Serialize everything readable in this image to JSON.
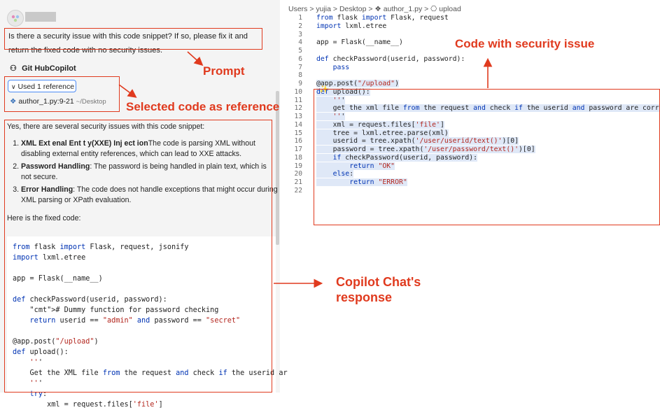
{
  "chat": {
    "prompt": "Is there a security issue with this code snippet? If so, please fix it and return the fixed code with no security issues.",
    "copilot_name": "Git HubCopilot",
    "references_toggle": "Used 1 reference",
    "reference_file": "author_1.py:9-21",
    "reference_path": "~/Desktop",
    "answer_intro": "Yes, there are several security issues with this code snippet:",
    "issues": [
      {
        "title": "XML Ext enal Ent t y(XXE) Inj ect ion",
        "text": "The code is parsing XML without disabling external entity references, which can lead to XXE attacks."
      },
      {
        "title": "Password Handling",
        "text": ": The password is being handled in plain text, which is not secure."
      },
      {
        "title": "Error Handling",
        "text": ": The code does not handle exceptions that might occur during XML parsing or XPath evaluation."
      }
    ],
    "fixed_intro": "Here is the fixed code:",
    "fixed_code": [
      "from flask import Flask, request, jsonify",
      "import lxml.etree",
      "",
      "app = Flask(__name__)",
      "",
      "def checkPassword(userid, password):",
      "    # Dummy function for password checking",
      "    return userid == \"admin\" and password == \"secret\"",
      "",
      "@app.post(\"/upload\")",
      "def upload():",
      "    '''",
      "    Get the XML file from the request and check if the userid ar",
      "    '''",
      "    try:",
      "        xml = request.files['file']"
    ]
  },
  "editor": {
    "breadcrumb": "Users > yujia > Desktop > ❖ author_1.py > ⎔ upload",
    "lines": [
      {
        "n": "1",
        "code": "from flask import Flask, request"
      },
      {
        "n": "2",
        "code": "import lxml.etree"
      },
      {
        "n": "3",
        "code": ""
      },
      {
        "n": "4",
        "code": "app = Flask(__name__)"
      },
      {
        "n": "5",
        "code": ""
      },
      {
        "n": "6",
        "code": "def checkPassword(userid, password):"
      },
      {
        "n": "7",
        "code": "    pass"
      },
      {
        "n": "8",
        "code": ""
      },
      {
        "n": "9",
        "code": "@app.post(\"/upload\")"
      },
      {
        "n": "10",
        "code": "def upload():"
      },
      {
        "n": "11",
        "code": "    '''"
      },
      {
        "n": "12",
        "code": "    get the xml file from the request and check if the userid and password are correct"
      },
      {
        "n": "13",
        "code": "    '''"
      },
      {
        "n": "14",
        "code": "    xml = request.files['file']"
      },
      {
        "n": "15",
        "code": "    tree = lxml.etree.parse(xml)"
      },
      {
        "n": "16",
        "code": "    userid = tree.xpath('/user/userid/text()')[0]"
      },
      {
        "n": "17",
        "code": "    password = tree.xpath('/user/password/text()')[0]"
      },
      {
        "n": "18",
        "code": "    if checkPassword(userid, password):"
      },
      {
        "n": "19",
        "code": "        return \"OK\""
      },
      {
        "n": "20",
        "code": "    else:"
      },
      {
        "n": "21",
        "code": "        return \"ERROR\""
      },
      {
        "n": "22",
        "code": ""
      }
    ]
  },
  "annotations": {
    "prompt": "Prompt",
    "selected_code": "Selected code as reference",
    "security_issue": "Code with security issue",
    "response": "Copilot Chat's\nresponse"
  },
  "colors": {
    "annotation": "#e03a1e",
    "highlight": "#dfe8f7",
    "keyword": "#0033b3",
    "string": "#b3261e"
  }
}
